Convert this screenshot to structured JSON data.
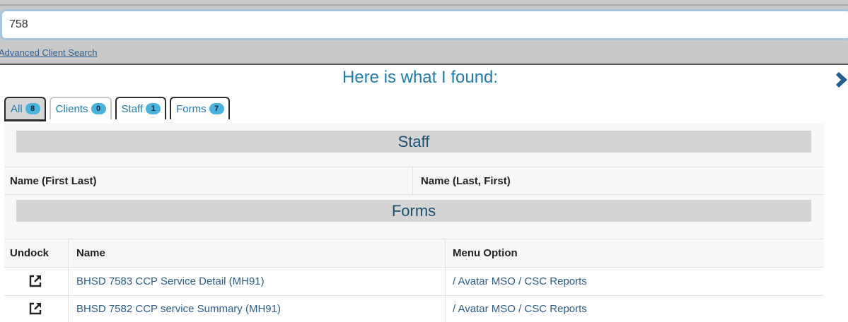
{
  "search": {
    "value": "758",
    "advanced_link": "Advanced Client Search"
  },
  "results": {
    "title": "Here is what I found:"
  },
  "tabs": [
    {
      "label": "All",
      "count": "8"
    },
    {
      "label": "Clients",
      "count": "0"
    },
    {
      "label": "Staff",
      "count": "1"
    },
    {
      "label": "Forms",
      "count": "7"
    }
  ],
  "staff": {
    "section_title": "Staff",
    "columns": [
      "Name (First Last)",
      "Name (Last, First)"
    ]
  },
  "forms": {
    "section_title": "Forms",
    "columns": [
      "Undock",
      "Name",
      "Menu Option"
    ],
    "rows": [
      {
        "name": "BHSD 7583 CCP Service Detail (MH91)",
        "menu_option": "/ Avatar MSO / CSC Reports"
      },
      {
        "name": "BHSD 7582 CCP service Summary (MH91)",
        "menu_option": "/ Avatar MSO / CSC Reports"
      }
    ]
  },
  "colors": {
    "accent": "#1f7cae",
    "badge": "#49b3dd",
    "section_bg": "#d4d4d4"
  },
  "icons": {
    "close": "chevron-right-icon",
    "undock": "external-link-icon"
  }
}
